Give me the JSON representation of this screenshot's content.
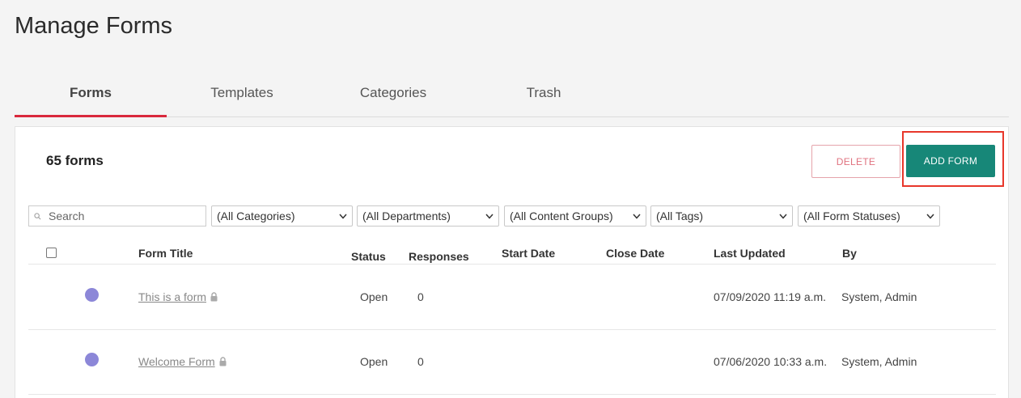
{
  "page": {
    "title": "Manage Forms"
  },
  "tabs": [
    {
      "label": "Forms",
      "active": true
    },
    {
      "label": "Templates",
      "active": false
    },
    {
      "label": "Categories",
      "active": false
    },
    {
      "label": "Trash",
      "active": false
    }
  ],
  "toolbar": {
    "count_label": "65 forms",
    "delete_label": "DELETE",
    "add_label": "ADD FORM"
  },
  "filters": {
    "search_placeholder": "Search",
    "search_icon": "search-icon",
    "categories": "(All Categories)",
    "departments": "(All Departments)",
    "content_groups": "(All Content Groups)",
    "tags": "(All Tags)",
    "statuses": "(All Form Statuses)"
  },
  "table": {
    "headers": {
      "title": "Form Title",
      "status": "Status",
      "responses": "Responses",
      "start_date": "Start Date",
      "close_date": "Close Date",
      "last_updated": "Last Updated",
      "by": "By"
    },
    "rows": [
      {
        "title": "This is a form",
        "status": "Open",
        "responses": "0",
        "start_date": "",
        "close_date": "",
        "last_updated": "07/09/2020 11:19 a.m.",
        "by": "System, Admin"
      },
      {
        "title": "Welcome Form",
        "status": "Open",
        "responses": "0",
        "start_date": "",
        "close_date": "",
        "last_updated": "07/06/2020 10:33 a.m.",
        "by": "System, Admin"
      }
    ]
  },
  "colors": {
    "accent_tab": "#d9283c",
    "add_button": "#178778",
    "delete_border": "#e5a4ab",
    "highlight": "#e8372b",
    "status_dot": "#8c87d8"
  }
}
